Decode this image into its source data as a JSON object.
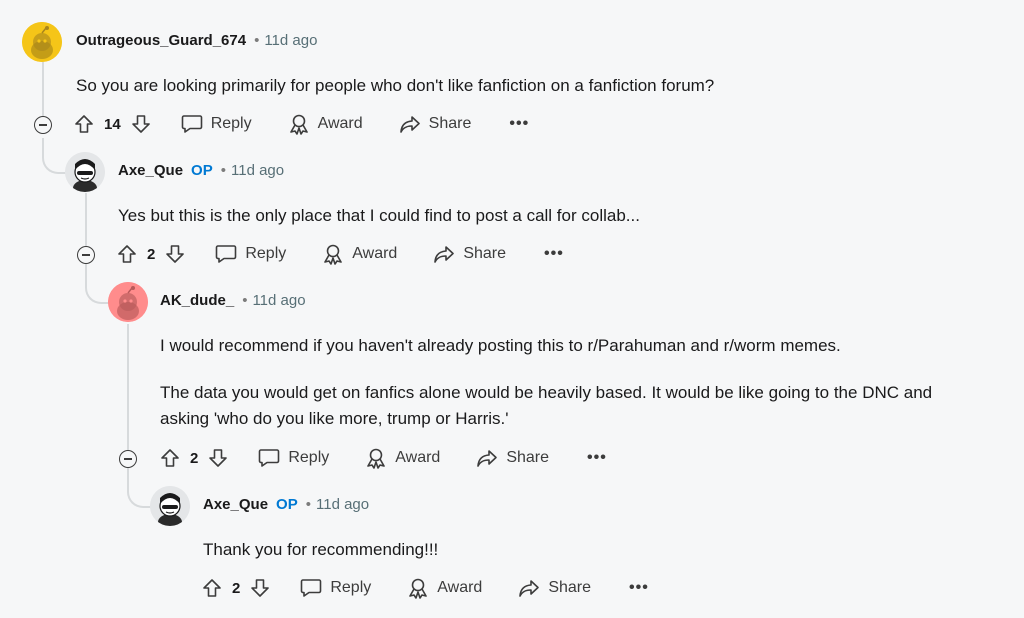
{
  "comments": [
    {
      "author": "Outrageous_Guard_674",
      "op_badge": "",
      "separator": "•",
      "time": "11d ago",
      "body": [
        "So you are looking primarily for people who don't like fanfiction on a fanfiction forum?"
      ],
      "score": "14",
      "avatar_color": "#f5c518"
    },
    {
      "author": "Axe_Que",
      "op_badge": "OP",
      "separator": "•",
      "time": "11d ago",
      "body": [
        "Yes but this is the only place that I could find to post a call for collab..."
      ],
      "score": "2"
    },
    {
      "author": "AK_dude_",
      "op_badge": "",
      "separator": "•",
      "time": "11d ago",
      "body_parts": {
        "pre": "I would recommend if you haven't already posting this to ",
        "link1": "r/Parahuman",
        "mid": " and ",
        "link2": "r/worm",
        "post": " memes."
      },
      "body": [
        "The data you would get on fanfics alone would be heavily based. It would be like going to the DNC and",
        "asking 'who do you like more, trump or Harris.'"
      ],
      "score": "2",
      "avatar_color": "#ff8c8c"
    },
    {
      "author": "Axe_Que",
      "op_badge": "OP",
      "separator": "•",
      "time": "11d ago",
      "body": [
        "Thank you for recommending!!!"
      ],
      "score": "2"
    }
  ],
  "actions": {
    "reply": "Reply",
    "award": "Award",
    "share": "Share",
    "more": "•••"
  },
  "icons": {
    "upvote": "upvote-arrow-icon",
    "downvote": "downvote-arrow-icon",
    "reply": "speech-bubble-icon",
    "award": "award-ribbon-icon",
    "share": "share-arrow-icon",
    "collapse": "minus-circle-icon"
  }
}
